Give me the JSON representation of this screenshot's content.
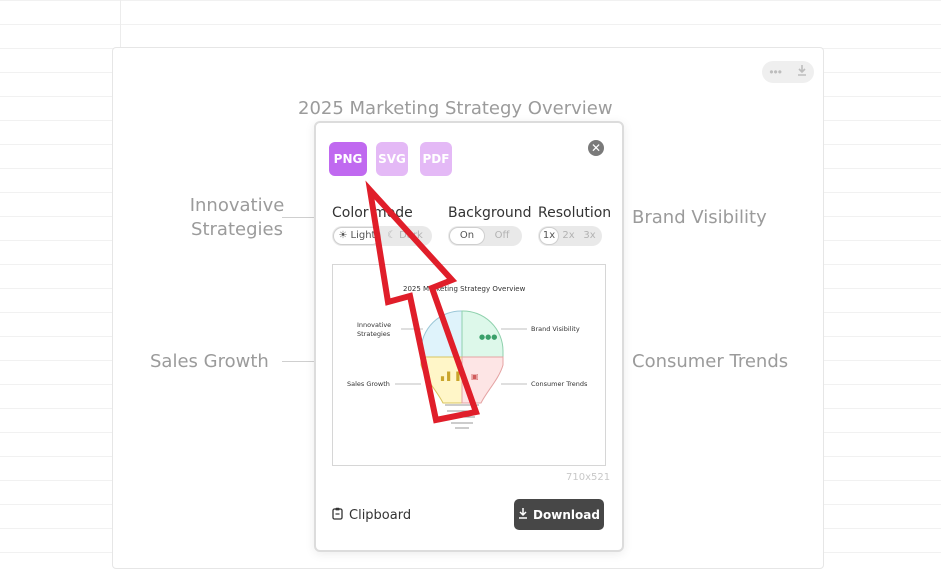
{
  "background": {
    "title": "2025 Marketing Strategy Overview",
    "labels": {
      "top_left": [
        "Innovative",
        "Strategies"
      ],
      "top_right": "Brand Visibility",
      "bottom_left": "Sales Growth",
      "bottom_right": "Consumer Trends"
    },
    "toolbar": {
      "more_icon": "more-icon",
      "download_icon": "download-icon"
    }
  },
  "export_dialog": {
    "formats": [
      {
        "label": "PNG",
        "selected": true
      },
      {
        "label": "SVG",
        "selected": false
      },
      {
        "label": "PDF",
        "selected": false
      }
    ],
    "colors": {
      "selected": "#c069f0",
      "unselected": "#e4b9f6"
    },
    "color_mode": {
      "label": "Color mode",
      "options": [
        "Light",
        "Dark"
      ],
      "selected": "Light"
    },
    "background": {
      "label": "Background",
      "options": [
        "On",
        "Off"
      ],
      "selected": "On"
    },
    "resolution": {
      "label": "Resolution",
      "options": [
        "1x",
        "2x",
        "3x"
      ],
      "selected": "1x"
    },
    "preview": {
      "title": "2025 Marketing Strategy Overview",
      "labels": {
        "innovative": [
          "Innovative",
          "Strategies"
        ],
        "brand": "Brand Visibility",
        "sales": "Sales Growth",
        "consumer": "Consumer Trends"
      },
      "dimensions": "710x521"
    },
    "clipboard_label": "Clipboard",
    "download_label": "Download"
  }
}
